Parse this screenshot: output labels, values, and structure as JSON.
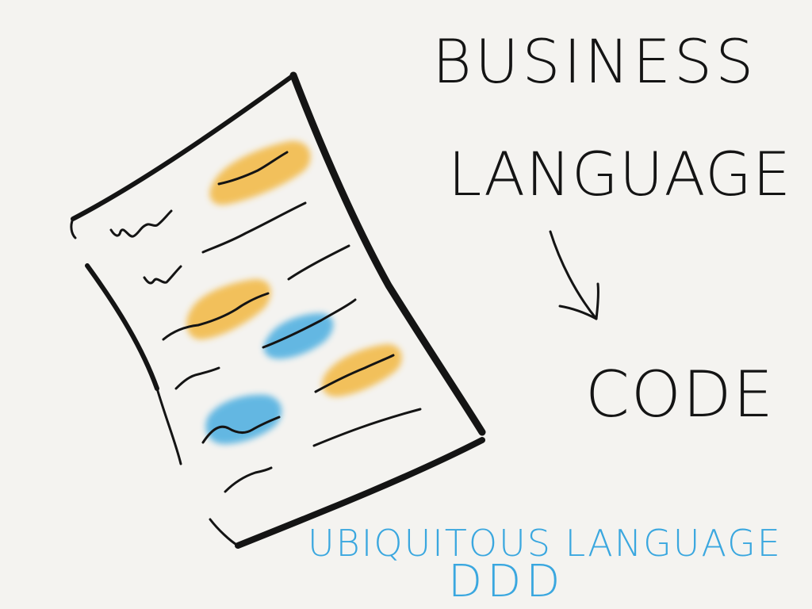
{
  "labels": {
    "business": "Business",
    "language": "Language",
    "code": "Code",
    "ubiquitous_language": "Ubiquitous Language",
    "ddd": "DDD"
  },
  "colors": {
    "background": "#f4f3f0",
    "ink": "#141414",
    "highlight_orange": "#f2b233",
    "highlight_blue": "#3aa7df",
    "caption_blue": "#3aa7df"
  },
  "icons": {
    "document": "document-icon",
    "arrow": "arrow-down-right-icon"
  }
}
